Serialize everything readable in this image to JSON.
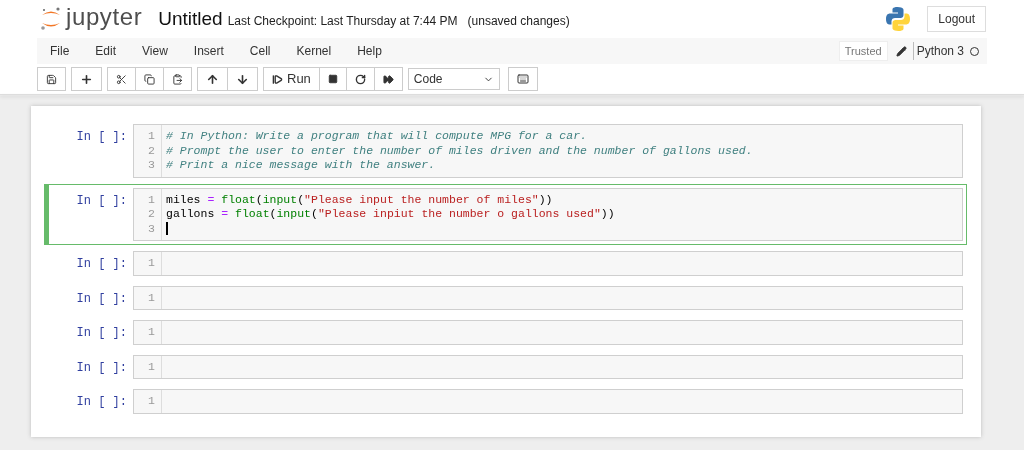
{
  "header": {
    "logo": "jupyter",
    "notebook_title": "Untitled",
    "checkpoint": "Last Checkpoint: Last Thursday at 7:44 PM",
    "save_status": "(unsaved changes)",
    "logout": "Logout"
  },
  "menu": [
    "File",
    "Edit",
    "View",
    "Insert",
    "Cell",
    "Kernel",
    "Help"
  ],
  "kernel": {
    "trusted": "Trusted",
    "name": "Python 3",
    "busy": false
  },
  "toolbar": {
    "run_label": "Run",
    "cell_type": "Code"
  },
  "cells": [
    {
      "prompt": "In [ ]:",
      "selected": false,
      "lines": [
        {
          "number": "1",
          "cursor": false,
          "tokens": [
            {
              "kind": "comment",
              "text": "# In Python: Write a program that will compute MPG for a car."
            }
          ]
        },
        {
          "number": "2",
          "cursor": false,
          "tokens": [
            {
              "kind": "comment",
              "text": "# Prompt the user to enter the number of miles driven and the number of gallons used."
            }
          ]
        },
        {
          "number": "3",
          "cursor": false,
          "tokens": [
            {
              "kind": "comment",
              "text": "# Print a nice message with the answer."
            }
          ]
        }
      ]
    },
    {
      "prompt": "In [ ]:",
      "selected": true,
      "lines": [
        {
          "number": "1",
          "cursor": false,
          "tokens": [
            {
              "kind": "name",
              "text": "miles "
            },
            {
              "kind": "operator",
              "text": "= "
            },
            {
              "kind": "builtin",
              "text": "float"
            },
            {
              "kind": "name",
              "text": "("
            },
            {
              "kind": "builtin",
              "text": "input"
            },
            {
              "kind": "name",
              "text": "("
            },
            {
              "kind": "string",
              "text": "\"Please input the number of miles\""
            },
            {
              "kind": "name",
              "text": "))"
            }
          ]
        },
        {
          "number": "2",
          "cursor": false,
          "tokens": [
            {
              "kind": "name",
              "text": "gallons "
            },
            {
              "kind": "operator",
              "text": "= "
            },
            {
              "kind": "builtin",
              "text": "float"
            },
            {
              "kind": "name",
              "text": "("
            },
            {
              "kind": "builtin",
              "text": "input"
            },
            {
              "kind": "name",
              "text": "("
            },
            {
              "kind": "string",
              "text": "\"Please inpiut the number o gallons used\""
            },
            {
              "kind": "name",
              "text": "))"
            }
          ]
        },
        {
          "number": "3",
          "cursor": true
        }
      ]
    },
    {
      "prompt": "In [ ]:",
      "selected": false,
      "lines": [
        {
          "number": "1",
          "cursor": false
        }
      ]
    },
    {
      "prompt": "In [ ]:",
      "selected": false,
      "lines": [
        {
          "number": "1",
          "cursor": false
        }
      ]
    },
    {
      "prompt": "In [ ]:",
      "selected": false,
      "lines": [
        {
          "number": "1",
          "cursor": false
        }
      ]
    },
    {
      "prompt": "In [ ]:",
      "selected": false,
      "lines": [
        {
          "number": "1",
          "cursor": false
        }
      ]
    },
    {
      "prompt": "In [ ]:",
      "selected": false,
      "lines": [
        {
          "number": "1",
          "cursor": false
        }
      ]
    }
  ]
}
